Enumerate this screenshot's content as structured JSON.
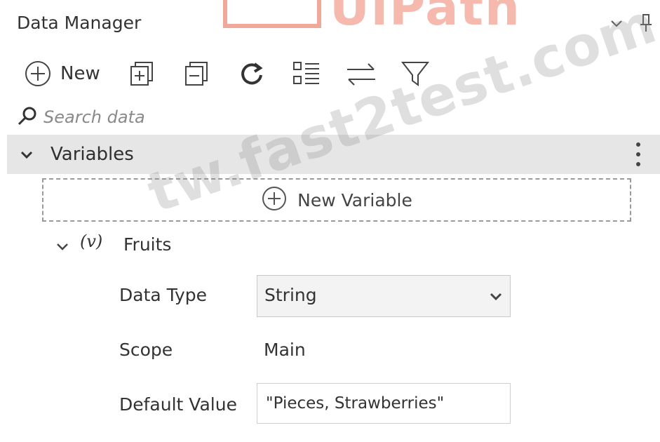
{
  "watermark": {
    "logo_text": "UiPath",
    "site_text": "tw.fast2test.com"
  },
  "panel": {
    "title": "Data Manager"
  },
  "toolbar": {
    "new_label": "New",
    "icons": [
      "add-circle-icon",
      "expand-all-icon",
      "collapse-all-icon",
      "refresh-icon",
      "list-view-icon",
      "sort-icon",
      "filter-icon"
    ]
  },
  "search": {
    "placeholder": "Search data"
  },
  "group": {
    "title": "Variables"
  },
  "new_variable": {
    "label": "New Variable"
  },
  "variable": {
    "icon_text": "(v)",
    "name": "Fruits",
    "data_type_label": "Data Type",
    "data_type_value": "String",
    "scope_label": "Scope",
    "scope_value": "Main",
    "default_value_label": "Default Value",
    "default_value": "\"Pieces, Strawberries\""
  },
  "colors": {
    "group_header_bg": "#e6e6e6",
    "logo_accent": "#f0a89a",
    "text": "#2b2b2b"
  }
}
